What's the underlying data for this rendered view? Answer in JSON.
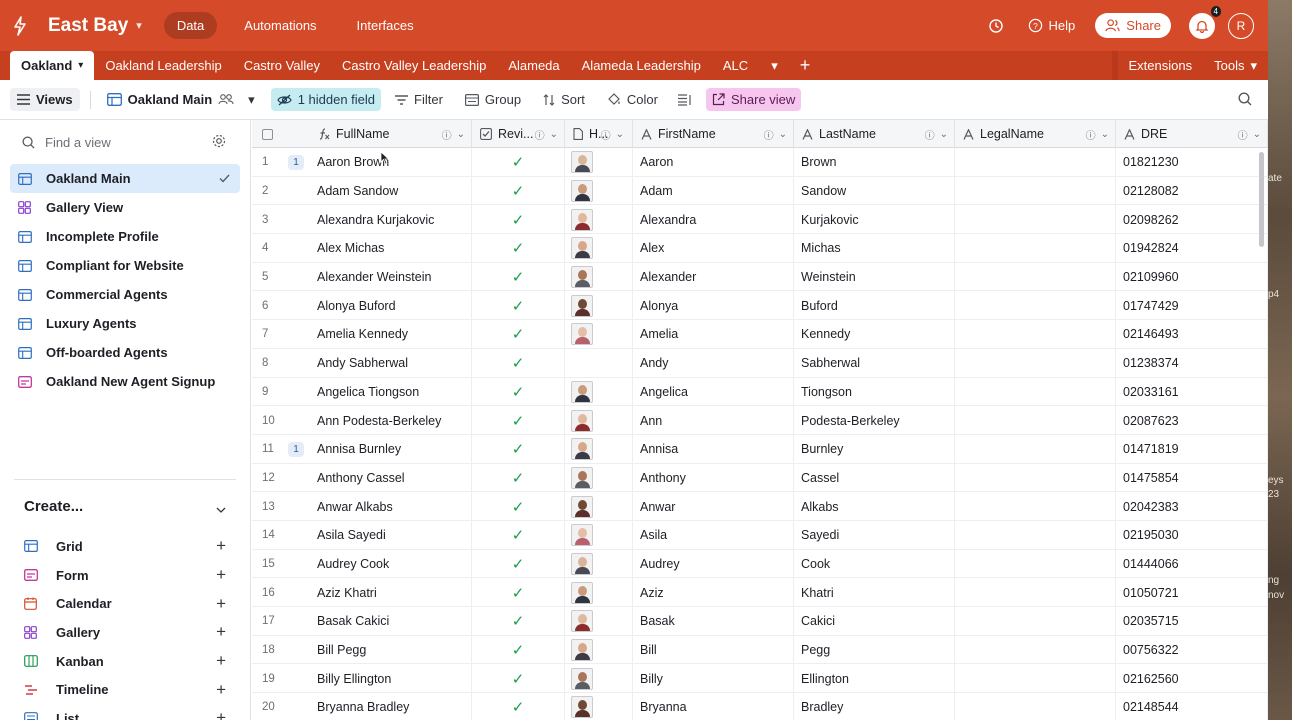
{
  "app": {
    "base_name": "East Bay",
    "nav_tabs": [
      "Data",
      "Automations",
      "Interfaces"
    ],
    "help_label": "Help",
    "share_label": "Share",
    "notification_count": "4",
    "avatar_initial": "R",
    "accent": "#d54a28"
  },
  "table_tabs": {
    "active": "Oakland",
    "others": [
      "Oakland Leadership",
      "Castro Valley",
      "Castro Valley Leadership",
      "Alameda",
      "Alameda Leadership",
      "ALC"
    ],
    "extensions_label": "Extensions",
    "tools_label": "Tools"
  },
  "toolbar": {
    "views_label": "Views",
    "view_name": "Oakland Main",
    "hidden_fields_label": "1 hidden field",
    "filter_label": "Filter",
    "group_label": "Group",
    "sort_label": "Sort",
    "color_label": "Color",
    "share_view_label": "Share view"
  },
  "sidebar": {
    "find_placeholder": "Find a view",
    "views": [
      {
        "label": "Oakland Main",
        "icon": "grid-icon",
        "active": true
      },
      {
        "label": "Gallery View",
        "icon": "gallery-icon"
      },
      {
        "label": "Incomplete Profile",
        "icon": "grid-icon"
      },
      {
        "label": "Compliant for Website",
        "icon": "grid-icon"
      },
      {
        "label": "Commercial Agents",
        "icon": "grid-icon"
      },
      {
        "label": "Luxury Agents",
        "icon": "grid-icon"
      },
      {
        "label": "Off-boarded Agents",
        "icon": "grid-icon"
      },
      {
        "label": "Oakland New Agent Signup",
        "icon": "form-icon"
      }
    ],
    "create_label": "Create...",
    "create_items": [
      "Grid",
      "Form",
      "Calendar",
      "Gallery",
      "Kanban",
      "Timeline",
      "List"
    ]
  },
  "grid": {
    "columns": [
      "FullName",
      "Revi...",
      "H...",
      "FirstName",
      "LastName",
      "LegalName",
      "DRE"
    ],
    "rows": [
      {
        "n": "1",
        "c": "1",
        "full": "Aaron Brown",
        "first": "Aaron",
        "last": "Brown",
        "dre": "01821230",
        "photo": true
      },
      {
        "n": "2",
        "full": "Adam Sandow",
        "first": "Adam",
        "last": "Sandow",
        "dre": "02128082",
        "photo": true
      },
      {
        "n": "3",
        "full": "Alexandra Kurjakovic",
        "first": "Alexandra",
        "last": "Kurjakovic",
        "dre": "02098262",
        "photo": true
      },
      {
        "n": "4",
        "full": "Alex Michas",
        "first": "Alex",
        "last": "Michas",
        "dre": "01942824",
        "photo": true
      },
      {
        "n": "5",
        "full": "Alexander Weinstein",
        "first": "Alexander",
        "last": "Weinstein",
        "dre": "02109960",
        "photo": true
      },
      {
        "n": "6",
        "full": "Alonya Buford",
        "first": "Alonya",
        "last": "Buford",
        "dre": "01747429",
        "photo": true
      },
      {
        "n": "7",
        "full": "Amelia Kennedy",
        "first": "Amelia",
        "last": "Kennedy",
        "dre": "02146493",
        "photo": true
      },
      {
        "n": "8",
        "full": "Andy Sabherwal",
        "first": "Andy",
        "last": "Sabherwal",
        "dre": "01238374",
        "photo": false
      },
      {
        "n": "9",
        "full": "Angelica Tiongson",
        "first": "Angelica",
        "last": "Tiongson",
        "dre": "02033161",
        "photo": true
      },
      {
        "n": "10",
        "full": "Ann Podesta-Berkeley",
        "first": "Ann",
        "last": "Podesta-Berkeley",
        "dre": "02087623",
        "photo": true
      },
      {
        "n": "11",
        "c": "1",
        "full": "Annisa Burnley",
        "first": "Annisa",
        "last": "Burnley",
        "dre": "01471819",
        "photo": true
      },
      {
        "n": "12",
        "full": "Anthony Cassel",
        "first": "Anthony",
        "last": "Cassel",
        "dre": "01475854",
        "photo": true
      },
      {
        "n": "13",
        "full": "Anwar Alkabs",
        "first": "Anwar",
        "last": "Alkabs",
        "dre": "02042383",
        "photo": true
      },
      {
        "n": "14",
        "full": "Asila Sayedi",
        "first": "Asila",
        "last": "Sayedi",
        "dre": "02195030",
        "photo": true
      },
      {
        "n": "15",
        "full": "Audrey Cook",
        "first": "Audrey",
        "last": "Cook",
        "dre": "01444066",
        "photo": true
      },
      {
        "n": "16",
        "full": "Aziz Khatri",
        "first": "Aziz",
        "last": "Khatri",
        "dre": "01050721",
        "photo": true
      },
      {
        "n": "17",
        "full": "Basak Cakici",
        "first": "Basak",
        "last": "Cakici",
        "dre": "02035715",
        "photo": true
      },
      {
        "n": "18",
        "full": "Bill Pegg",
        "first": "Bill",
        "last": "Pegg",
        "dre": "00756322",
        "photo": true
      },
      {
        "n": "19",
        "full": "Billy Ellington",
        "first": "Billy",
        "last": "Ellington",
        "dre": "02162560",
        "photo": true
      },
      {
        "n": "20",
        "full": "Bryanna Bradley",
        "first": "Bryanna",
        "last": "Bradley",
        "dre": "02148544",
        "photo": true
      }
    ]
  },
  "desktop_fragments": [
    "ate",
    "p4",
    "eys",
    "23",
    "ng",
    "nov"
  ]
}
